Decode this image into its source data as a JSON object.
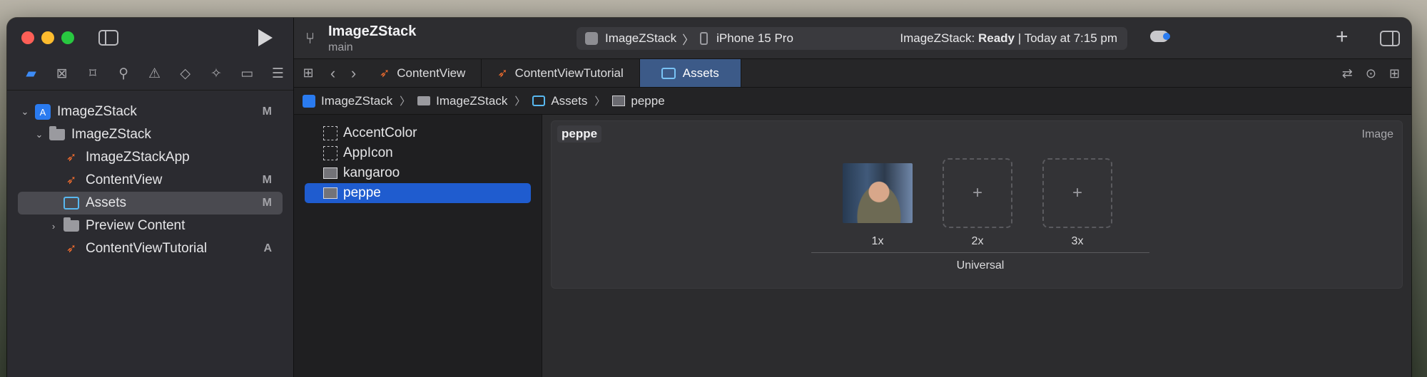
{
  "window": {
    "project_name": "ImageZStack",
    "branch": "main"
  },
  "scheme": {
    "app": "ImageZStack",
    "separator": "〉",
    "device": "iPhone 15 Pro",
    "status_prefix": "ImageZStack:",
    "status_state": "Ready",
    "status_time": "| Today at 7:15 pm"
  },
  "navigator": {
    "icons": [
      "folder-icon",
      "source-control-icon",
      "bookmark-icon",
      "find-icon",
      "issue-icon",
      "test-icon",
      "debug-icon",
      "breakpoint-icon",
      "report-icon"
    ],
    "tree": [
      {
        "label": "ImageZStack",
        "badge": "M"
      },
      {
        "label": "ImageZStack",
        "badge": ""
      },
      {
        "label": "ImageZStackApp",
        "badge": ""
      },
      {
        "label": "ContentView",
        "badge": "M"
      },
      {
        "label": "Assets",
        "badge": "M"
      },
      {
        "label": "Preview Content",
        "badge": ""
      },
      {
        "label": "ContentViewTutorial",
        "badge": "A"
      }
    ]
  },
  "tabs": [
    {
      "label": "ContentView"
    },
    {
      "label": "ContentViewTutorial"
    },
    {
      "label": "Assets"
    }
  ],
  "breadcrumb": [
    "ImageZStack",
    "ImageZStack",
    "Assets",
    "peppe"
  ],
  "assets": [
    {
      "label": "AccentColor"
    },
    {
      "label": "AppIcon"
    },
    {
      "label": "kangaroo"
    },
    {
      "label": "peppe"
    }
  ],
  "detail": {
    "set_name": "peppe",
    "set_type": "Image",
    "slots": [
      "1x",
      "2x",
      "3x"
    ],
    "group_label": "Universal",
    "add_glyph": "+"
  },
  "colors": {
    "accent": "#1f5ccf",
    "active_tab": "#3c5a88",
    "swift": "#f26d2e"
  }
}
